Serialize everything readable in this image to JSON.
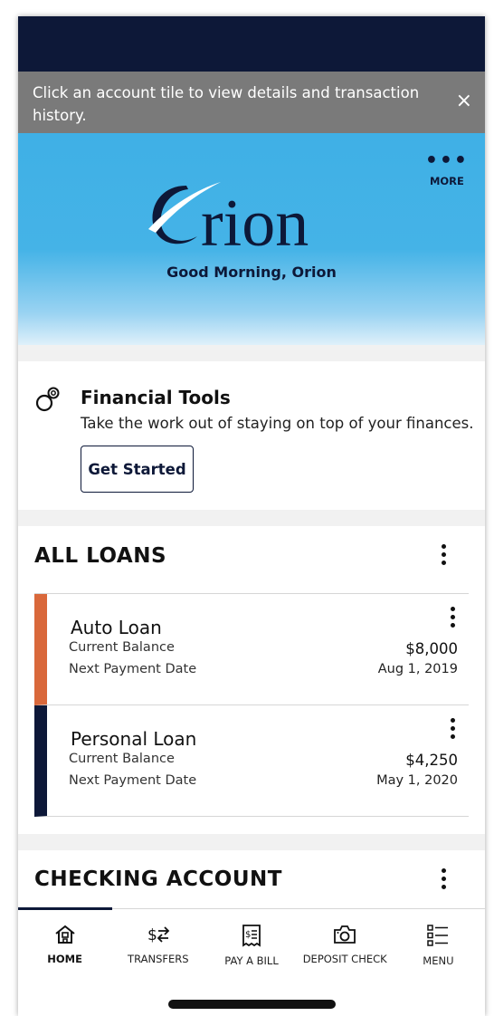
{
  "banner": {
    "message": "Click an account tile to view details and transaction history.",
    "close_symbol": "×"
  },
  "hero": {
    "brand_name": "Orion",
    "logo_rest": "rion",
    "greeting": "Good Morning, Orion",
    "more_dots": "•••",
    "more_label": "MORE"
  },
  "financial_tools": {
    "title": "Financial Tools",
    "description": "Take the work out of staying on top of your finances.",
    "button_label": "Get Started",
    "icon": "coins-icon"
  },
  "loans": {
    "title": "ALL LOANS",
    "items": [
      {
        "name": "Auto Loan",
        "balance_label": "Current Balance",
        "balance": "$8,000",
        "payment_label": "Next Payment Date",
        "payment_date": "Aug 1, 2019",
        "color": "#d9683b"
      },
      {
        "name": "Personal Loan",
        "balance_label": "Current Balance",
        "balance": "$4,250",
        "payment_label": "Next Payment Date",
        "payment_date": "May 1, 2020",
        "color": "#0d1838"
      }
    ]
  },
  "checking": {
    "title": "CHECKING ACCOUNT"
  },
  "tabbar": {
    "tabs": [
      {
        "label": "HOME",
        "icon": "home-icon",
        "active": true
      },
      {
        "label": "TRANSFERS",
        "icon": "transfers-icon",
        "active": false
      },
      {
        "label": "PAY A BILL",
        "icon": "bill-icon",
        "active": false
      },
      {
        "label": "DEPOSIT CHECK",
        "icon": "camera-icon",
        "active": false
      },
      {
        "label": "MENU",
        "icon": "menu-list-icon",
        "active": false
      }
    ]
  },
  "colors": {
    "navy": "#0d1838",
    "sky": "#45b3e7",
    "banner_gray": "#7a7a7a",
    "auto_loan_accent": "#d9683b"
  }
}
